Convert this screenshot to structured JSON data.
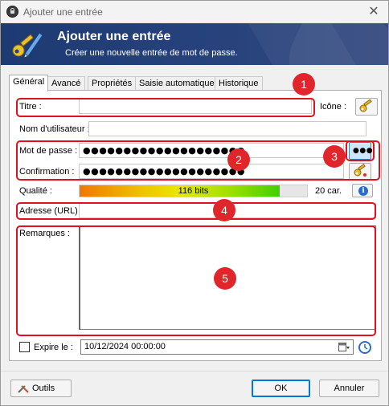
{
  "window": {
    "title": "Ajouter une entrée"
  },
  "banner": {
    "title": "Ajouter une entrée",
    "subtitle": "Créer une nouvelle entrée de mot de passe."
  },
  "tabs": [
    {
      "label": "Général",
      "active": true
    },
    {
      "label": "Avancé"
    },
    {
      "label": "Propriétés"
    },
    {
      "label": "Saisie automatique"
    },
    {
      "label": "Historique"
    }
  ],
  "form": {
    "title_label": "Titre :",
    "title_value": "",
    "icon_label": "Icône :",
    "username_label": "Nom d'utilisateur :",
    "username_value": "",
    "password_label": "Mot de passe :",
    "password_value": "●●●●●●●●●●●●●●●●●●●●",
    "confirm_label": "Confirmation :",
    "confirm_value": "●●●●●●●●●●●●●●●●●●●●",
    "toggle_password_label": "●●●",
    "quality_label": "Qualité :",
    "quality_bits": "116 bits",
    "quality_fraction": 0.88,
    "quality_chars": "20 car.",
    "url_label": "Adresse (URL) :",
    "url_value": "",
    "notes_label": "Remarques :",
    "notes_value": "",
    "expires_label": "Expire le :",
    "expires_checked": false,
    "expires_value": "10/12/2024 00:00:00"
  },
  "annotations": [
    "1",
    "2",
    "3",
    "4",
    "5"
  ],
  "footer": {
    "tools_label": "Outils",
    "ok_label": "OK",
    "cancel_label": "Annuler"
  },
  "colors": {
    "banner": "#1d3a73",
    "annotation_red": "#e0101e",
    "accent_blue": "#0078d7"
  }
}
